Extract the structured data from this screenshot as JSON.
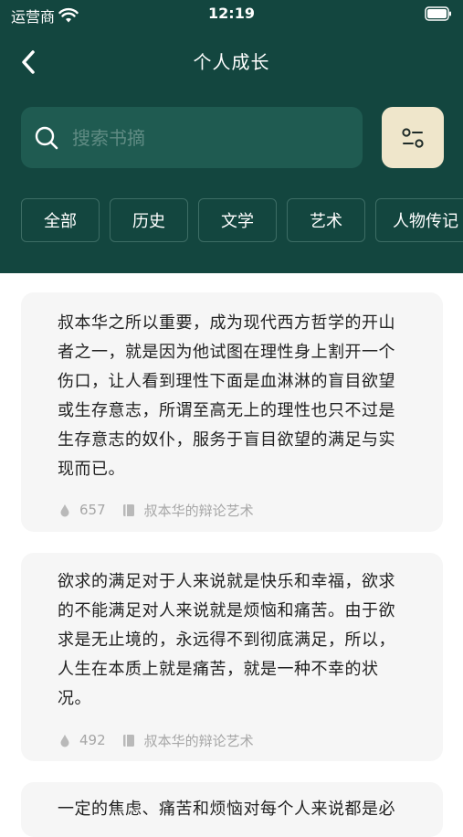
{
  "status_bar": {
    "carrier": "运营商",
    "time": "12:19"
  },
  "nav": {
    "title": "个人成长",
    "back_icon": "chevron-left-icon"
  },
  "search": {
    "placeholder": "搜索书摘",
    "value": ""
  },
  "filter_icon": "filter-settings-icon",
  "tabs": [
    {
      "label": "全部"
    },
    {
      "label": "历史"
    },
    {
      "label": "文学"
    },
    {
      "label": "艺术"
    },
    {
      "label": "人物传记"
    }
  ],
  "excerpts": [
    {
      "text": "叔本华之所以重要，成为现代西方哲学的开山者之一，就是因为他试图在理性身上割开一个伤口，让人看到理性下面是血淋淋的盲目欲望或生存意志，所谓至高无上的理性也只不过是生存意志的奴仆，服务于盲目欲望的满足与实现而已。",
      "likes": "657",
      "book": "叔本华的辩论艺术"
    },
    {
      "text": "欲求的满足对于人来说就是快乐和幸福，欲求的不能满足对人来说就是烦恼和痛苦。由于欲求是无止境的，永远得不到彻底满足，所以，人生在本质上就是痛苦，就是一种不幸的状况。",
      "likes": "492",
      "book": "叔本华的辩论艺术"
    },
    {
      "text": "一定的焦虑、痛苦和烦恼对每个人来说都是必"
    }
  ],
  "colors": {
    "header_bg": "#13463f",
    "search_bg": "#1f5b51",
    "filter_bg": "#efe6cb",
    "card_bg": "#f6f6f6"
  }
}
